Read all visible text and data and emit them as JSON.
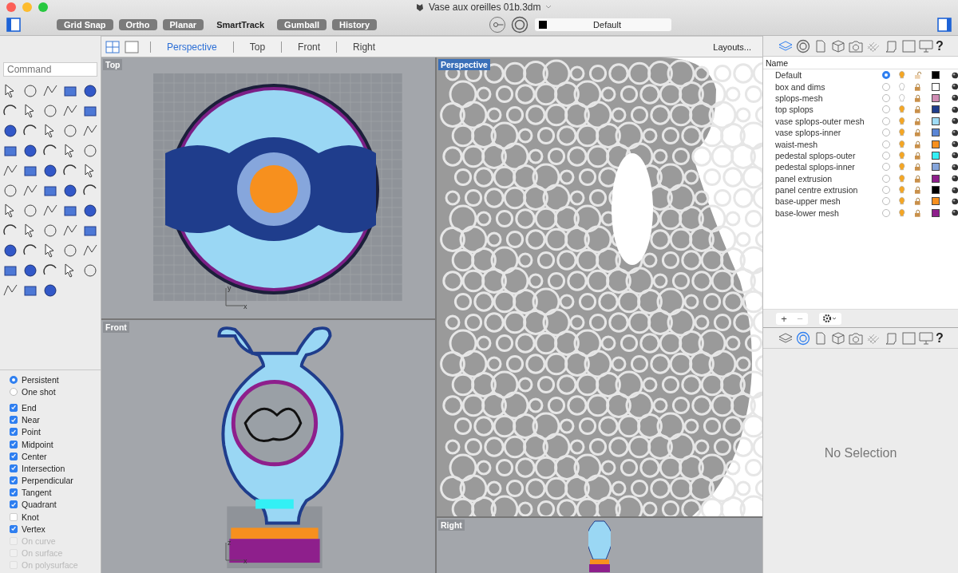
{
  "window": {
    "title": "Vase aux oreilles 01b.3dm"
  },
  "toolbar": {
    "toggles": [
      {
        "label": "Grid Snap",
        "on": true
      },
      {
        "label": "Ortho",
        "on": true
      },
      {
        "label": "Planar",
        "on": true
      },
      {
        "label": "SmartTrack",
        "on": false
      },
      {
        "label": "Gumball",
        "on": true
      },
      {
        "label": "History",
        "on": true
      }
    ],
    "layer_dropdown": {
      "value": "Default",
      "color": "#000000"
    }
  },
  "viewport_tabs": [
    {
      "label": "Perspective",
      "selected": true
    },
    {
      "label": "Top",
      "selected": false
    },
    {
      "label": "Front",
      "selected": false
    },
    {
      "label": "Right",
      "selected": false
    }
  ],
  "layouts_button": "Layouts...",
  "command_field": {
    "placeholder": "Command"
  },
  "osnap": {
    "modes": [
      {
        "label": "Persistent",
        "selected": true
      },
      {
        "label": "One shot",
        "selected": false
      }
    ],
    "snaps": [
      {
        "label": "End",
        "checked": true,
        "disabled": false
      },
      {
        "label": "Near",
        "checked": true,
        "disabled": false
      },
      {
        "label": "Point",
        "checked": true,
        "disabled": false
      },
      {
        "label": "Midpoint",
        "checked": true,
        "disabled": false
      },
      {
        "label": "Center",
        "checked": true,
        "disabled": false
      },
      {
        "label": "Intersection",
        "checked": true,
        "disabled": false
      },
      {
        "label": "Perpendicular",
        "checked": true,
        "disabled": false
      },
      {
        "label": "Tangent",
        "checked": true,
        "disabled": false
      },
      {
        "label": "Quadrant",
        "checked": true,
        "disabled": false
      },
      {
        "label": "Knot",
        "checked": false,
        "disabled": false
      },
      {
        "label": "Vertex",
        "checked": true,
        "disabled": false
      },
      {
        "label": "On curve",
        "checked": false,
        "disabled": true
      },
      {
        "label": "On surface",
        "checked": false,
        "disabled": true
      },
      {
        "label": "On polysurface",
        "checked": false,
        "disabled": true
      }
    ]
  },
  "viewports": [
    {
      "title": "Top",
      "kind": "top",
      "active": false,
      "axes": [
        "x",
        "y"
      ]
    },
    {
      "title": "Front",
      "kind": "front",
      "active": false,
      "axes": [
        "x",
        "z"
      ]
    },
    {
      "title": "Perspective",
      "kind": "perspective",
      "active": true
    },
    {
      "title": "Right",
      "kind": "right",
      "active": false
    }
  ],
  "layer_panel": {
    "tabs": [
      {
        "kind": "layers",
        "selected": true
      },
      {
        "kind": "target",
        "selected": false
      },
      {
        "kind": "page",
        "selected": false
      },
      {
        "kind": "cube",
        "selected": false
      },
      {
        "kind": "camera",
        "selected": false
      },
      {
        "kind": "grid",
        "selected": false
      },
      {
        "kind": "scroll",
        "selected": false
      },
      {
        "kind": "square",
        "selected": false
      },
      {
        "kind": "monitor",
        "selected": false
      },
      {
        "kind": "help",
        "selected": false,
        "label": "?"
      }
    ],
    "column": "Name",
    "layers": [
      {
        "name": "Default",
        "current": true,
        "on": true,
        "locked": false,
        "color": "#000000"
      },
      {
        "name": "box and dims",
        "current": false,
        "on": false,
        "locked": true,
        "color": "#ffffff"
      },
      {
        "name": "splops-mesh",
        "current": false,
        "on": false,
        "locked": true,
        "color": "#d08cb4"
      },
      {
        "name": "top splops",
        "current": false,
        "on": true,
        "locked": true,
        "color": "#1f3d8c"
      },
      {
        "name": "vase splops-outer mesh",
        "current": false,
        "on": true,
        "locked": true,
        "color": "#9fdcf6"
      },
      {
        "name": "vase splops-inner",
        "current": false,
        "on": true,
        "locked": true,
        "color": "#5b86d6"
      },
      {
        "name": "waist-mesh",
        "current": false,
        "on": true,
        "locked": true,
        "color": "#f7901e"
      },
      {
        "name": "pedestal splops-outer",
        "current": false,
        "on": true,
        "locked": true,
        "color": "#33f0f5"
      },
      {
        "name": "pedestal splops-inner",
        "current": false,
        "on": true,
        "locked": true,
        "color": "#86a6dc"
      },
      {
        "name": "panel extrusion",
        "current": false,
        "on": true,
        "locked": true,
        "color": "#8e1f8c"
      },
      {
        "name": "panel centre extrusion",
        "current": false,
        "on": true,
        "locked": true,
        "color": "#000000"
      },
      {
        "name": "base-upper mesh",
        "current": false,
        "on": true,
        "locked": true,
        "color": "#f7901e"
      },
      {
        "name": "base-lower mesh",
        "current": false,
        "on": true,
        "locked": true,
        "color": "#8e1f8c"
      }
    ],
    "buttons": [
      {
        "label": "+",
        "disabled": false
      },
      {
        "label": "−",
        "disabled": true
      }
    ]
  },
  "properties_panel": {
    "tabs": [
      {
        "kind": "layers",
        "selected": false
      },
      {
        "kind": "target",
        "selected": true
      },
      {
        "kind": "page",
        "selected": false
      },
      {
        "kind": "cube",
        "selected": false
      },
      {
        "kind": "camera",
        "selected": false
      },
      {
        "kind": "grid",
        "selected": false
      },
      {
        "kind": "scroll",
        "selected": false
      },
      {
        "kind": "square",
        "selected": false
      },
      {
        "kind": "monitor",
        "selected": false
      },
      {
        "kind": "help",
        "selected": false,
        "label": "?"
      }
    ],
    "message": "No Selection"
  }
}
